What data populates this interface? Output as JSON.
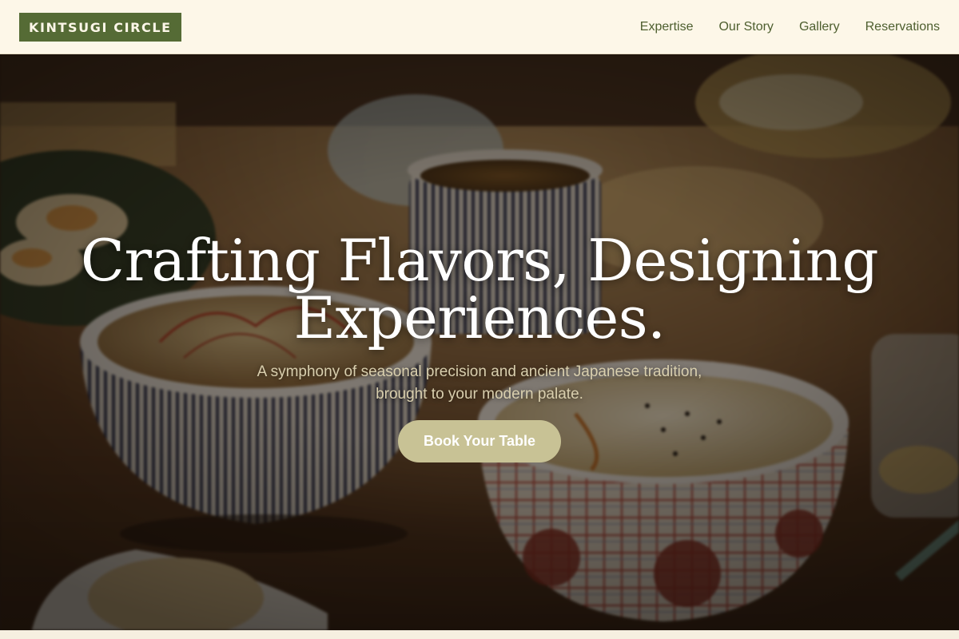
{
  "header": {
    "logo_text": "KINTSUGI CIRCLE",
    "nav": [
      {
        "label": "Expertise"
      },
      {
        "label": "Our Story"
      },
      {
        "label": "Gallery"
      },
      {
        "label": "Reservations"
      }
    ]
  },
  "hero": {
    "title_line1": "Crafting Flavors, Designing",
    "title_line2": "Experiences.",
    "subtitle_line1": "A symphony of seasonal precision and ancient Japanese tradition,",
    "subtitle_line2": "brought to your modern palate.",
    "cta_label": "Book Your Table",
    "background": "photo-of-japanese-rice-bowls-on-wooden-tray"
  },
  "colors": {
    "header_bg": "#fdf7e8",
    "logo_bg": "#556b35",
    "nav_text": "#4d5e2e",
    "cta_bg": "#c8c295",
    "subtitle_text": "#d9cfae"
  }
}
